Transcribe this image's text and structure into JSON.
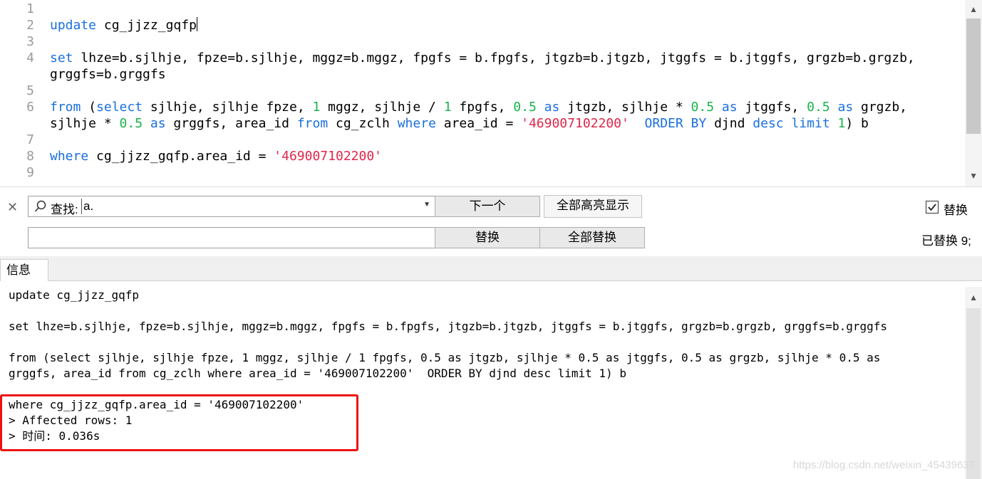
{
  "editor": {
    "line_numbers": [
      "1",
      "2",
      "3",
      "4",
      "5",
      "6",
      "7",
      "8",
      "9"
    ],
    "line2": {
      "kw_update": "update",
      "table": " cg_jjzz_gqfp"
    },
    "line4a": {
      "kw_set": "set",
      "text": " lhze=b.sjlhje, fpze=b.sjlhje, mggz=b.mggz, fpgfs = b.fpgfs, jtgzb=b.jtgzb, jtggfs = b.jtggfs, grgzb=b.grgzb,"
    },
    "line4b": "grggfs=b.grggfs",
    "line6a": {
      "kw_from": "from",
      "t1": " (",
      "kw_select": "select",
      "t2": " sjlhje, sjlhje fpze, ",
      "n1": "1",
      "t3": " mggz, sjlhje / ",
      "n2": "1",
      "t4": " fpgfs, ",
      "n3": "0.5",
      "kw_as1": " as",
      "t5": " jtgzb, sjlhje * ",
      "n4": "0.5",
      "kw_as2": " as",
      "t6": " jtggfs, ",
      "n5": "0.5",
      "kw_as3": " as",
      "t7": " grgzb,"
    },
    "line6b": {
      "t1": "sjlhje * ",
      "n1": "0.5",
      "kw_as": " as",
      "t2": " grggfs, area_id ",
      "kw_from": "from",
      "t3": " cg_zclh ",
      "kw_where": "where",
      "t4": " area_id = ",
      "s1": "'469007102200'",
      "t5": "  ",
      "kw_order": "ORDER BY",
      "t6": " djnd ",
      "kw_desc": "desc",
      "t7": " ",
      "kw_limit": "limit",
      "t8": " ",
      "n2": "1",
      "t9": ") b"
    },
    "line8": {
      "kw_where": "where",
      "t1": " cg_jjzz_gqfp.area_id = ",
      "s1": "'469007102200'"
    }
  },
  "findbar": {
    "find_label": "查找:",
    "find_value": "a.",
    "next_button": "下一个",
    "highlight_all_button": "全部高亮显示",
    "replace_toggle_label": "替换",
    "replace_toggle_checked": true,
    "replace_value": "",
    "replace_button": "替换",
    "replace_all_button": "全部替换",
    "status": "已替换 9;"
  },
  "info": {
    "tab_label": "信息",
    "lines": [
      "update cg_jjzz_gqfp",
      "set lhze=b.sjlhje, fpze=b.sjlhje, mggz=b.mggz, fpgfs = b.fpgfs, jtgzb=b.jtgzb, jtggfs = b.jtggfs, grgzb=b.grgzb, grggfs=b.grggfs",
      "from (select sjlhje, sjlhje fpze, 1 mggz, sjlhje / 1 fpgfs, 0.5 as jtgzb, sjlhje * 0.5 as jtggfs, 0.5 as grgzb, sjlhje * 0.5 as",
      "grggfs, area_id from cg_zclh where area_id = '469007102200'  ORDER BY djnd desc limit 1) b",
      "where cg_jjzz_gqfp.area_id = '469007102200'",
      "> Affected rows: 1",
      "> 时间: 0.036s"
    ]
  },
  "watermark": "https://blog.csdn.net/weixin_45439637",
  "colors": {
    "keyword": "#1a6fe0",
    "number": "#19b34a",
    "string": "#e0264a",
    "highlight_box": "#ee1111"
  },
  "icons": [
    "close-icon",
    "search-icon",
    "dropdown-arrow-icon",
    "checkbox-checked-icon",
    "scroll-up-icon",
    "scroll-down-icon"
  ]
}
